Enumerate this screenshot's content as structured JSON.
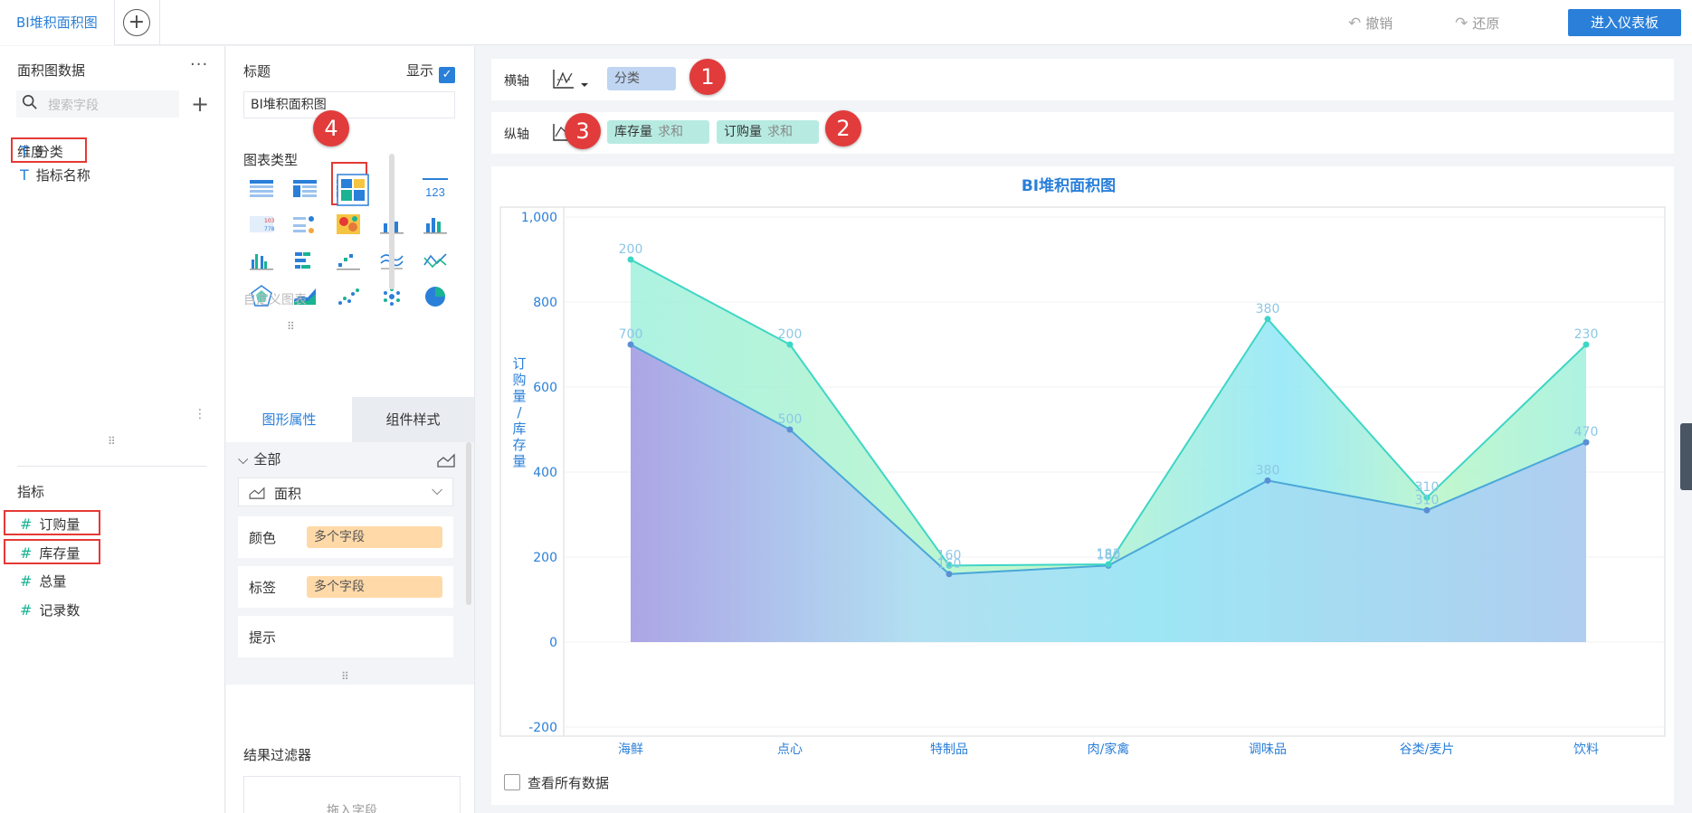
{
  "topbar": {
    "tab_label": "BI堆积面积图",
    "undo_label": "撤销",
    "redo_label": "还原",
    "enter_label": "进入仪表板"
  },
  "left_panel": {
    "title": "面积图数据",
    "more": "···",
    "search_placeholder": "搜索字段",
    "dimension_label": "维度",
    "dimensions": [
      "分类",
      "指标名称"
    ],
    "measure_label": "指标",
    "measures": [
      "订购量",
      "库存量",
      "总量",
      "记录数"
    ]
  },
  "config_panel": {
    "title_label": "标题",
    "show_label": "显示",
    "title_value": "BI堆积面积图",
    "chart_type_label": "图表类型",
    "custom_chart_label": "自定义图表",
    "tab_graph": "图形属性",
    "tab_style": "组件样式",
    "all_label": "全部",
    "shape_label": "面积",
    "color_label": "颜色",
    "color_value": "多个字段",
    "tag_label": "标签",
    "tag_value": "多个字段",
    "tooltip_label": "提示",
    "filter_label": "结果过滤器",
    "filter_drop": "拖入字段"
  },
  "axes": {
    "x_label": "横轴",
    "x_field": "分类",
    "y_label": "纵轴",
    "y_fields": [
      {
        "name": "库存量",
        "agg": "求和"
      },
      {
        "name": "订购量",
        "agg": "求和"
      }
    ],
    "badges": [
      "1",
      "2",
      "3",
      "4"
    ]
  },
  "chart_data": {
    "type": "area",
    "title": "BI堆积面积图",
    "ylabel": "订购量/库存量",
    "categories": [
      "海鲜",
      "点心",
      "特制品",
      "肉/家禽",
      "调味品",
      "谷类/麦片",
      "饮料"
    ],
    "series": [
      {
        "name": "库存量",
        "values": [
          700,
          500,
          160,
          180,
          380,
          310,
          470
        ]
      },
      {
        "name": "订购量",
        "values": [
          200,
          200,
          20,
          3,
          380,
          30,
          230
        ]
      }
    ],
    "stacked_labels": [
      "200",
      "200",
      "160",
      "183",
      "380",
      "310",
      "230"
    ],
    "yticks": [
      "-200",
      "0",
      "200",
      "400",
      "600",
      "800",
      "1,000"
    ],
    "ylim": [
      -200,
      1000
    ],
    "stacked": true,
    "colors": {
      "lower": "#9b8fe0",
      "upper": "#3be0c0",
      "title": "#2a7fd9"
    }
  },
  "view_all_label": "查看所有数据"
}
